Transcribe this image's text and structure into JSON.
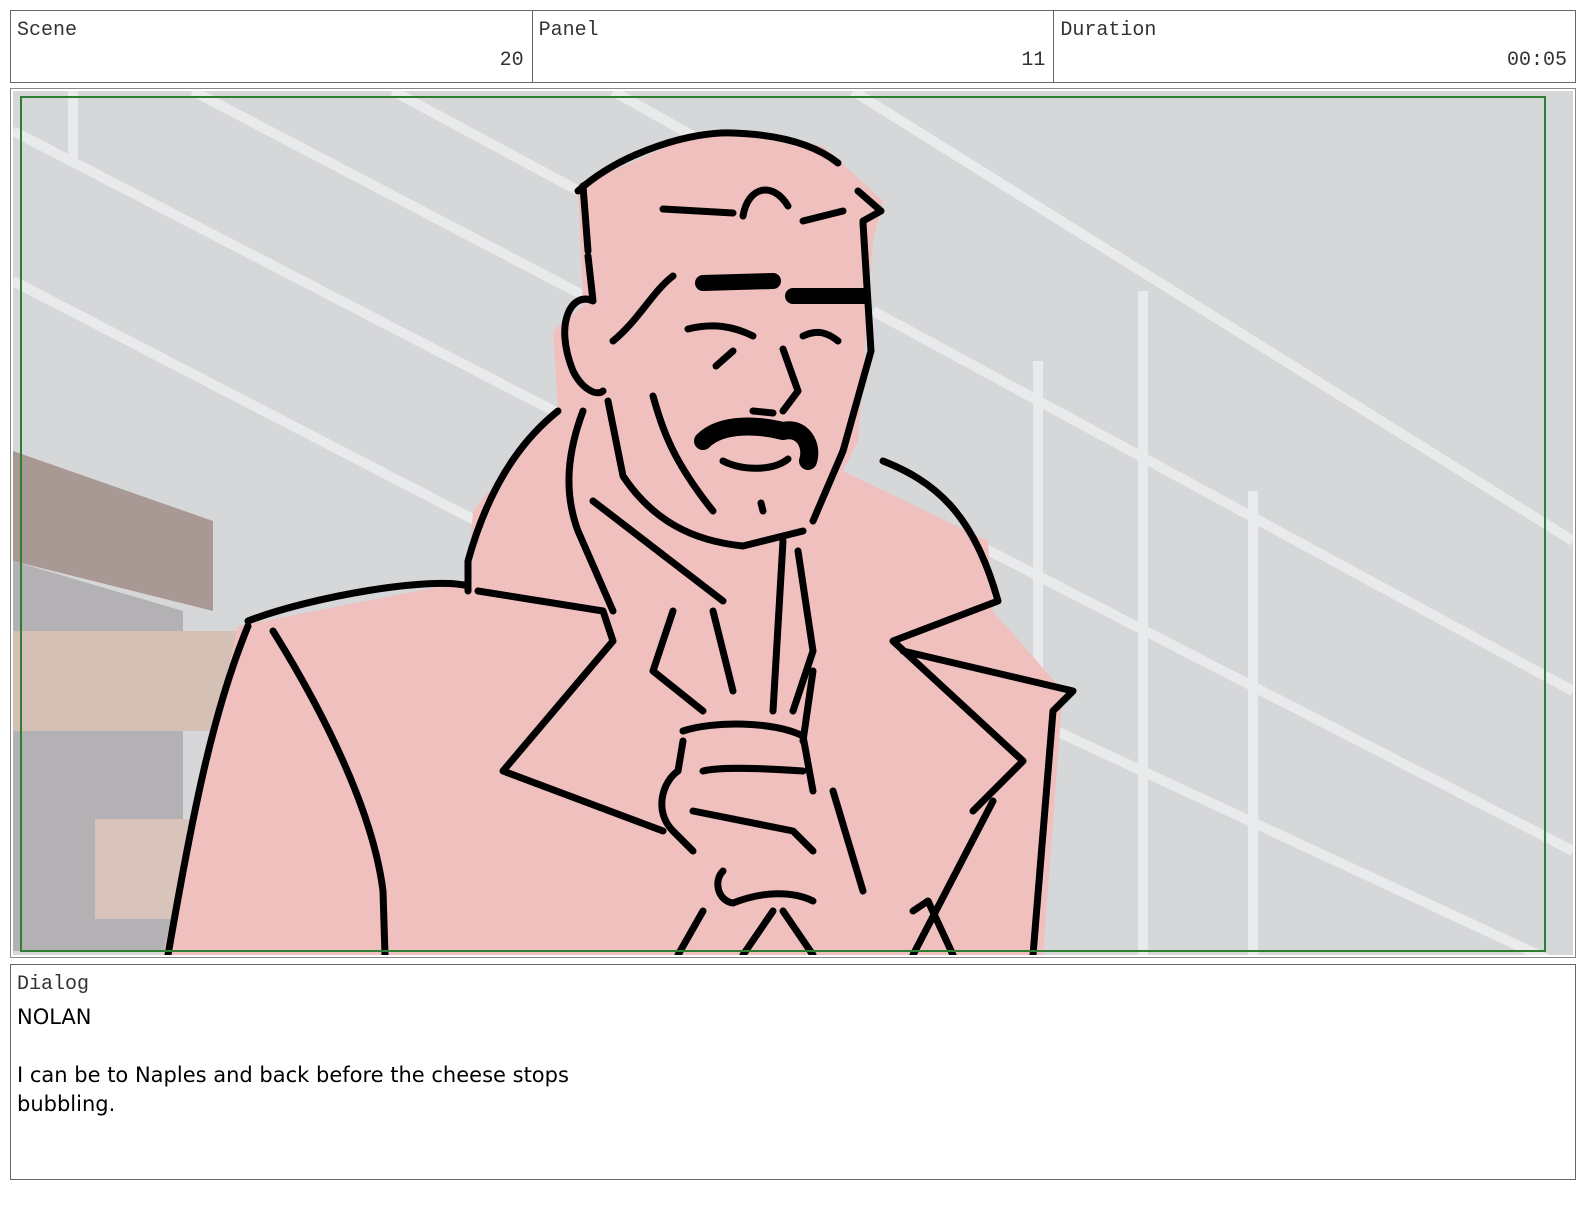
{
  "header": {
    "scene": {
      "label": "Scene",
      "value": "20"
    },
    "panel": {
      "label": "Panel",
      "value": "11"
    },
    "duration": {
      "label": "Duration",
      "value": "00:05"
    }
  },
  "frame": {
    "safe_area_color": "#2e7d32",
    "background_color": "#d6d7d9",
    "character_fill": "#f0c0bf",
    "line_color": "#000000"
  },
  "dialog": {
    "label": "Dialog",
    "speaker": "NOLAN",
    "line": "I can be to Naples and back before the cheese stops bubbling."
  }
}
